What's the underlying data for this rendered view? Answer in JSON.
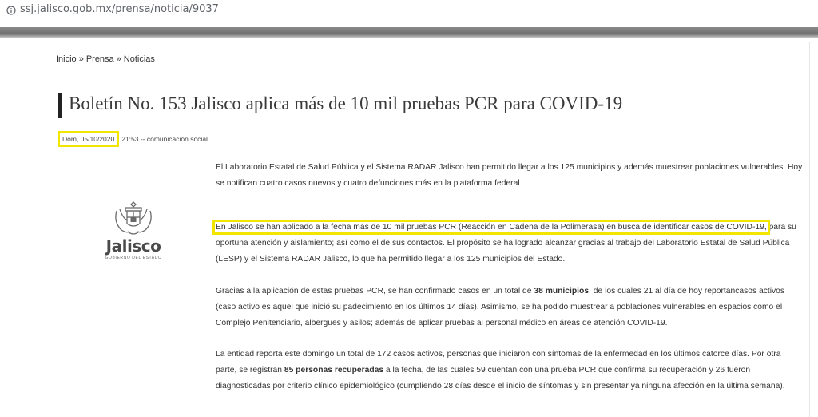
{
  "browser": {
    "url": "ssj.jalisco.gob.mx/prensa/noticia/9037"
  },
  "breadcrumb": {
    "items": [
      "Inicio",
      "Prensa",
      "Noticias"
    ],
    "separator": "»"
  },
  "article": {
    "title": "Boletín No. 153 Jalisco aplica más de 10 mil pruebas PCR para COVID-19",
    "date": "Dom, 05/10/2020",
    "time_author": "21:53 -- comunicación.social",
    "p1": "El Laboratorio Estatal de Salud Pública y el Sistema RADAR Jalisco han permitido llegar a los 125 municipios y además muestrear poblaciones vulnerables. Hoy se notifican cuatro casos nuevos y cuatro defunciones más en la plataforma federal",
    "p2_highlight": "En Jalisco se han aplicado a la fecha más de 10 mil pruebas PCR (Reacción en Cadena de la Polimerasa) en busca de identificar casos de COVID-19,",
    "p2_rest": " para su oportuna atención y aislamiento; así como el de sus contactos. El propósito se ha logrado alcanzar gracias al trabajo del Laboratorio Estatal de Salud Pública (LESP) y el Sistema RADAR Jalisco, lo que ha permitido llegar a los 125 municipios del Estado.",
    "p3_a": "Gracias a la aplicación de estas pruebas PCR, se han confirmado casos en un total de ",
    "p3_bold": "38 municipios",
    "p3_b": ", de los cuales 21 al día de hoy reportancasos activos (caso activo es aquel que inició su padecimiento en los últimos 14 días). Asimismo, se ha podido muestrear a poblaciones vulnerables en espacios como el Complejo Penitenciario, albergues y asilos; además de aplicar pruebas al personal médico en áreas de atención COVID-19.",
    "p4_a": "La entidad reporta este domingo un total de 172 casos activos, personas que iniciaron con síntomas de la enfermedad en los últimos catorce días. Por otra parte, se registran ",
    "p4_bold": "85 personas recuperadas",
    "p4_b": " a la fecha, de las cuales 59 cuentan con una prueba PCR que confirma su recuperación y 26 fueron diagnosticadas por criterio clínico epidemiológico (cumpliendo 28 días desde el inicio de síntomas y sin presentar ya ninguna afección en la última semana)."
  },
  "logo": {
    "name": "Jalisco",
    "subtitle": "GOBIERNO DEL ESTADO"
  },
  "colors": {
    "highlight": "#f2e600",
    "text": "#333333"
  }
}
